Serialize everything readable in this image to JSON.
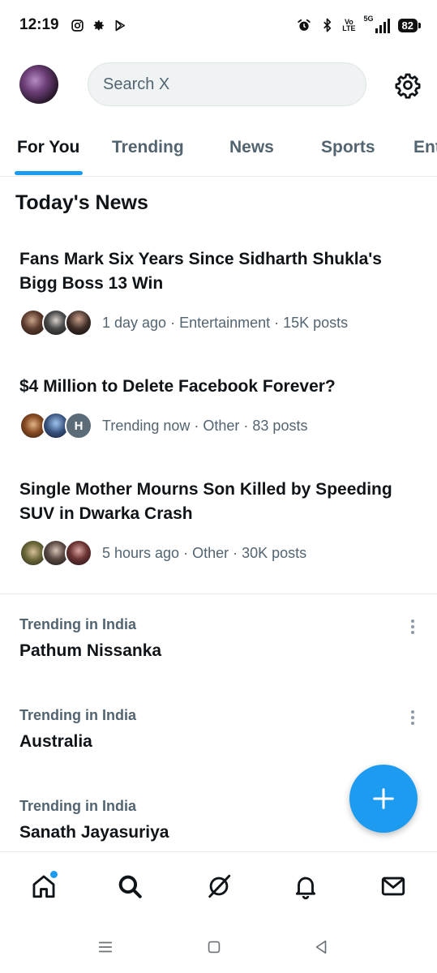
{
  "status_bar": {
    "time": "12:19",
    "left_icons": [
      "instagram-icon",
      "settings-icon",
      "play-store-icon"
    ],
    "right_icons": [
      "alarm-icon",
      "bluetooth-icon",
      "volte-icon",
      "signal-5g-icon"
    ],
    "volte_label": "Vo\nLTE",
    "network": "5G",
    "battery": "82"
  },
  "header": {
    "search_placeholder": "Search X"
  },
  "tabs": [
    {
      "label": "For You",
      "active": true
    },
    {
      "label": "Trending",
      "active": false
    },
    {
      "label": "News",
      "active": false
    },
    {
      "label": "Sports",
      "active": false
    },
    {
      "label": "Entertainment",
      "active": false
    }
  ],
  "section_title": "Today's News",
  "news": [
    {
      "headline": "Fans Mark Six Years Since Sidharth Shukla's Bigg Boss 13 Win",
      "meta": "1 day ago · Entertainment · 15K posts"
    },
    {
      "headline": "$4 Million to Delete Facebook Forever?",
      "meta": "Trending now · Other · 83 posts",
      "avatar_letter": "H"
    },
    {
      "headline": "Single Mother Mourns Son Killed by Speeding SUV in Dwarka Crash",
      "meta": "5 hours ago · Other · 30K posts"
    }
  ],
  "trends": [
    {
      "context": "Trending in India",
      "name": "Pathum Nissanka"
    },
    {
      "context": "Trending in India",
      "name": "Australia"
    },
    {
      "context": "Trending in India",
      "name": "Sanath Jayasuriya"
    }
  ],
  "bottom_nav": [
    "home-icon",
    "search-icon",
    "grok-icon",
    "notifications-icon",
    "messages-icon"
  ],
  "colors": {
    "accent": "#1d9bf0",
    "text_primary": "#0f1419",
    "text_secondary": "#536471"
  }
}
